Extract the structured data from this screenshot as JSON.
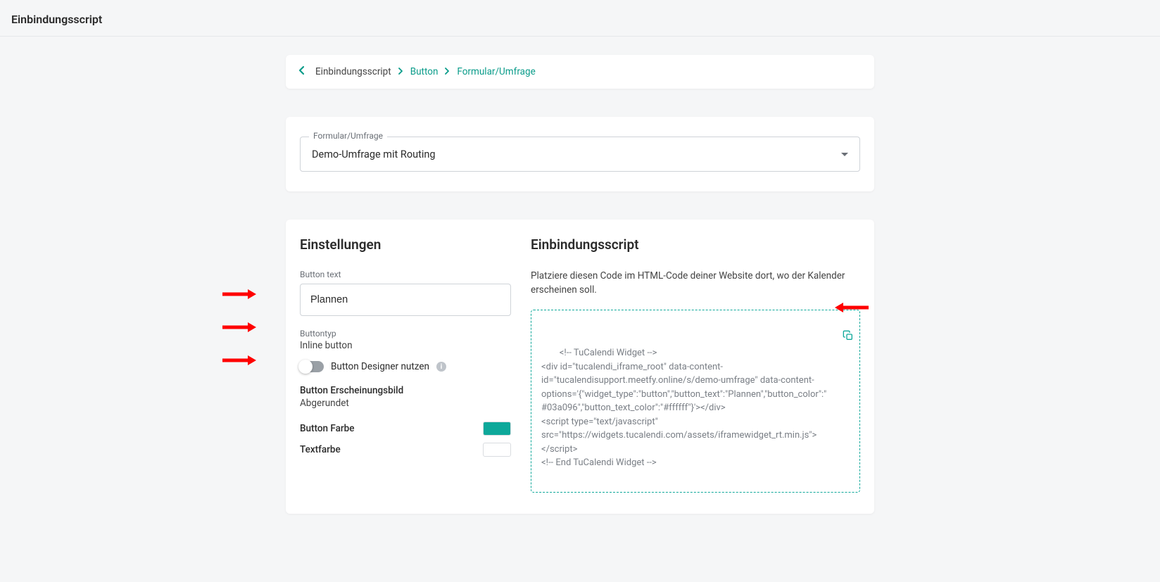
{
  "page_title": "Einbindungsscript",
  "breadcrumb": {
    "items": [
      "Einbindungsscript",
      "Button",
      "Formular/Umfrage"
    ]
  },
  "form_select": {
    "label": "Formular/Umfrage",
    "value": "Demo-Umfrage mit Routing"
  },
  "settings": {
    "title": "Einstellungen",
    "button_text_label": "Button text",
    "button_text_value": "Plannen",
    "button_type_label": "Buttontyp",
    "button_type_value": "Inline button",
    "designer_label": "Button Designer nutzen",
    "appearance_label": "Button Erscheinungsbild",
    "appearance_value": "Abgerundet",
    "button_color_label": "Button Farbe",
    "text_color_label": "Textfarbe",
    "button_color": "#0ea89a",
    "text_color": "#ffffff"
  },
  "embed": {
    "title": "Einbindungsscript",
    "description": "Platziere diesen Code im HTML-Code deiner Website dort, wo der Kalender erscheinen soll.",
    "code": "<!-- TuCalendi Widget -->\n<div id=\"tucalendi_iframe_root\" data-content-id=\"tucalendisupport.meetfy.online/s/demo-umfrage\" data-content-options='{\"widget_type\":\"button\",\"button_text\":\"Plannen\",\"button_color\":\"#03a096\",\"button_text_color\":\"#ffffff\"}'></div>\n<script type=\"text/javascript\" src=\"https://widgets.tucalendi.com/assets/iframewidget_rt.min.js\"></script>\n<!-- End TuCalendi Widget -->"
  }
}
